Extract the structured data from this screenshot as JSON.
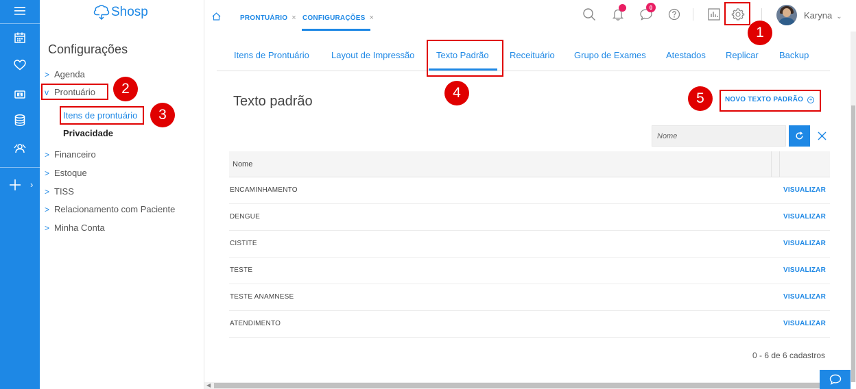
{
  "rail": {
    "icons": [
      "menu-icon",
      "calendar-icon",
      "heart-icon",
      "money-icon",
      "database-icon",
      "support-icon",
      "plus-icon"
    ]
  },
  "brand": {
    "logo_text": "Shosp"
  },
  "sidebar": {
    "title": "Configurações",
    "items": [
      {
        "label": "Agenda",
        "caret": ">"
      },
      {
        "label": "Prontuário",
        "caret": "v"
      },
      {
        "label": "Itens de prontuário"
      },
      {
        "label": "Privacidade"
      },
      {
        "label": "Financeiro",
        "caret": ">"
      },
      {
        "label": "Estoque",
        "caret": ">"
      },
      {
        "label": "TISS",
        "caret": ">"
      },
      {
        "label": "Relacionamento com Paciente",
        "caret": ">"
      },
      {
        "label": "Minha Conta",
        "caret": ">"
      }
    ]
  },
  "topbar": {
    "breadcrumbs": [
      {
        "label": "PRONTUÁRIO",
        "close": "×"
      },
      {
        "label": "CONFIGURAÇÕES",
        "close": "×"
      }
    ],
    "messages_badge": "0",
    "user_name": "Karyna",
    "user_dropdown": "⌄",
    "accent_color": "#1e88e5",
    "badge_color": "#e91e63"
  },
  "tabs": [
    "Itens de Prontuário",
    "Layout de Impressão",
    "Texto Padrão",
    "Receituário",
    "Grupo de Exames",
    "Atestados",
    "Replicar",
    "Backup"
  ],
  "active_tab": "Texto Padrão",
  "main": {
    "title": "Texto padrão",
    "new_button": "NOVO TEXTO PADRÃO",
    "search_placeholder": "Nome",
    "table": {
      "header": "Nome",
      "rows": [
        {
          "name": "ENCAMINHAMENTO",
          "action": "VISUALIZAR"
        },
        {
          "name": "DENGUE",
          "action": "VISUALIZAR"
        },
        {
          "name": "CISTITE",
          "action": "VISUALIZAR"
        },
        {
          "name": "TESTE",
          "action": "VISUALIZAR"
        },
        {
          "name": "TESTE ANAMNESE",
          "action": "VISUALIZAR"
        },
        {
          "name": "ATENDIMENTO",
          "action": "VISUALIZAR"
        }
      ]
    },
    "count": "0 - 6 de 6 cadastros"
  },
  "annotations": {
    "markers": [
      "1",
      "2",
      "3",
      "4",
      "5"
    ],
    "color": "#e00000"
  }
}
